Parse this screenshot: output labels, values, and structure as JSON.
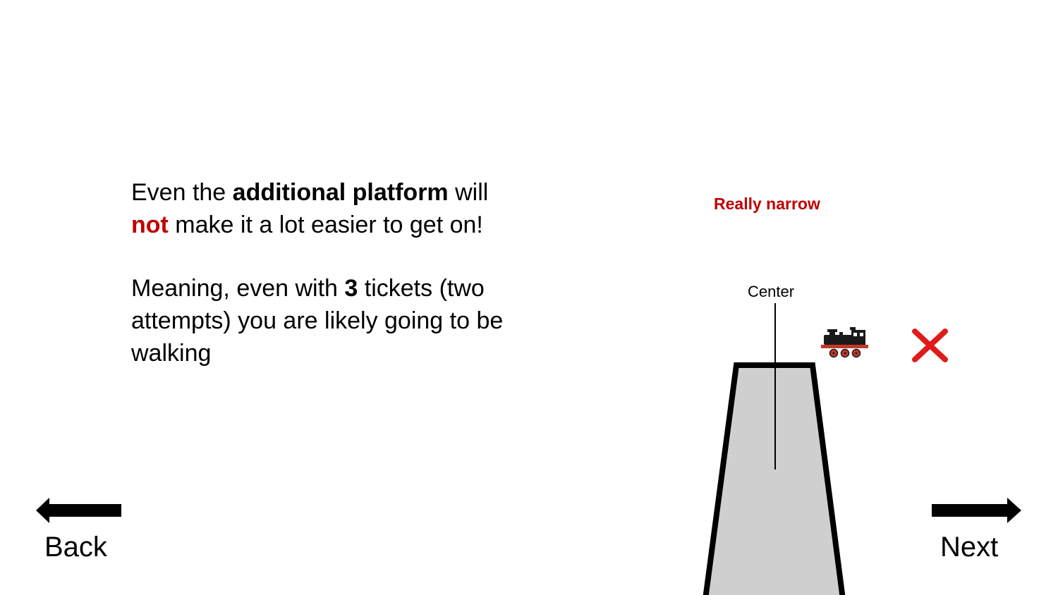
{
  "main_text": {
    "line1_pre": "Even the ",
    "line1_bold": "additional platform",
    "line1_post": " will",
    "line2_accent": "not",
    "line2_post": " make it a lot easier to get on!",
    "para2_pre": "Meaning, even with ",
    "para2_bold": "3",
    "para2_post": " tickets (two attempts) you are likely going to be walking"
  },
  "diagram": {
    "note": "Really narrow",
    "center_label": "Center",
    "icons": [
      "train-icon",
      "red-x-icon"
    ]
  },
  "navigation": {
    "back_label": "Back",
    "next_label": "Next"
  },
  "colors": {
    "accent": "#c00000",
    "platform_fill": "#d0cfcf",
    "x_mark": "#e01b1b"
  }
}
